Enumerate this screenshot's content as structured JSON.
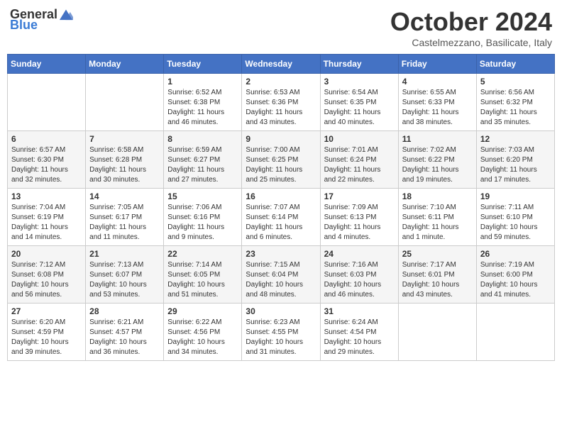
{
  "header": {
    "logo_general": "General",
    "logo_blue": "Blue",
    "month_title": "October 2024",
    "subtitle": "Castelmezzano, Basilicate, Italy"
  },
  "days_of_week": [
    "Sunday",
    "Monday",
    "Tuesday",
    "Wednesday",
    "Thursday",
    "Friday",
    "Saturday"
  ],
  "weeks": [
    [
      {
        "day": "",
        "info": ""
      },
      {
        "day": "",
        "info": ""
      },
      {
        "day": "1",
        "info": "Sunrise: 6:52 AM\nSunset: 6:38 PM\nDaylight: 11 hours and 46 minutes."
      },
      {
        "day": "2",
        "info": "Sunrise: 6:53 AM\nSunset: 6:36 PM\nDaylight: 11 hours and 43 minutes."
      },
      {
        "day": "3",
        "info": "Sunrise: 6:54 AM\nSunset: 6:35 PM\nDaylight: 11 hours and 40 minutes."
      },
      {
        "day": "4",
        "info": "Sunrise: 6:55 AM\nSunset: 6:33 PM\nDaylight: 11 hours and 38 minutes."
      },
      {
        "day": "5",
        "info": "Sunrise: 6:56 AM\nSunset: 6:32 PM\nDaylight: 11 hours and 35 minutes."
      }
    ],
    [
      {
        "day": "6",
        "info": "Sunrise: 6:57 AM\nSunset: 6:30 PM\nDaylight: 11 hours and 32 minutes."
      },
      {
        "day": "7",
        "info": "Sunrise: 6:58 AM\nSunset: 6:28 PM\nDaylight: 11 hours and 30 minutes."
      },
      {
        "day": "8",
        "info": "Sunrise: 6:59 AM\nSunset: 6:27 PM\nDaylight: 11 hours and 27 minutes."
      },
      {
        "day": "9",
        "info": "Sunrise: 7:00 AM\nSunset: 6:25 PM\nDaylight: 11 hours and 25 minutes."
      },
      {
        "day": "10",
        "info": "Sunrise: 7:01 AM\nSunset: 6:24 PM\nDaylight: 11 hours and 22 minutes."
      },
      {
        "day": "11",
        "info": "Sunrise: 7:02 AM\nSunset: 6:22 PM\nDaylight: 11 hours and 19 minutes."
      },
      {
        "day": "12",
        "info": "Sunrise: 7:03 AM\nSunset: 6:20 PM\nDaylight: 11 hours and 17 minutes."
      }
    ],
    [
      {
        "day": "13",
        "info": "Sunrise: 7:04 AM\nSunset: 6:19 PM\nDaylight: 11 hours and 14 minutes."
      },
      {
        "day": "14",
        "info": "Sunrise: 7:05 AM\nSunset: 6:17 PM\nDaylight: 11 hours and 11 minutes."
      },
      {
        "day": "15",
        "info": "Sunrise: 7:06 AM\nSunset: 6:16 PM\nDaylight: 11 hours and 9 minutes."
      },
      {
        "day": "16",
        "info": "Sunrise: 7:07 AM\nSunset: 6:14 PM\nDaylight: 11 hours and 6 minutes."
      },
      {
        "day": "17",
        "info": "Sunrise: 7:09 AM\nSunset: 6:13 PM\nDaylight: 11 hours and 4 minutes."
      },
      {
        "day": "18",
        "info": "Sunrise: 7:10 AM\nSunset: 6:11 PM\nDaylight: 11 hours and 1 minute."
      },
      {
        "day": "19",
        "info": "Sunrise: 7:11 AM\nSunset: 6:10 PM\nDaylight: 10 hours and 59 minutes."
      }
    ],
    [
      {
        "day": "20",
        "info": "Sunrise: 7:12 AM\nSunset: 6:08 PM\nDaylight: 10 hours and 56 minutes."
      },
      {
        "day": "21",
        "info": "Sunrise: 7:13 AM\nSunset: 6:07 PM\nDaylight: 10 hours and 53 minutes."
      },
      {
        "day": "22",
        "info": "Sunrise: 7:14 AM\nSunset: 6:05 PM\nDaylight: 10 hours and 51 minutes."
      },
      {
        "day": "23",
        "info": "Sunrise: 7:15 AM\nSunset: 6:04 PM\nDaylight: 10 hours and 48 minutes."
      },
      {
        "day": "24",
        "info": "Sunrise: 7:16 AM\nSunset: 6:03 PM\nDaylight: 10 hours and 46 minutes."
      },
      {
        "day": "25",
        "info": "Sunrise: 7:17 AM\nSunset: 6:01 PM\nDaylight: 10 hours and 43 minutes."
      },
      {
        "day": "26",
        "info": "Sunrise: 7:19 AM\nSunset: 6:00 PM\nDaylight: 10 hours and 41 minutes."
      }
    ],
    [
      {
        "day": "27",
        "info": "Sunrise: 6:20 AM\nSunset: 4:59 PM\nDaylight: 10 hours and 39 minutes."
      },
      {
        "day": "28",
        "info": "Sunrise: 6:21 AM\nSunset: 4:57 PM\nDaylight: 10 hours and 36 minutes."
      },
      {
        "day": "29",
        "info": "Sunrise: 6:22 AM\nSunset: 4:56 PM\nDaylight: 10 hours and 34 minutes."
      },
      {
        "day": "30",
        "info": "Sunrise: 6:23 AM\nSunset: 4:55 PM\nDaylight: 10 hours and 31 minutes."
      },
      {
        "day": "31",
        "info": "Sunrise: 6:24 AM\nSunset: 4:54 PM\nDaylight: 10 hours and 29 minutes."
      },
      {
        "day": "",
        "info": ""
      },
      {
        "day": "",
        "info": ""
      }
    ]
  ]
}
